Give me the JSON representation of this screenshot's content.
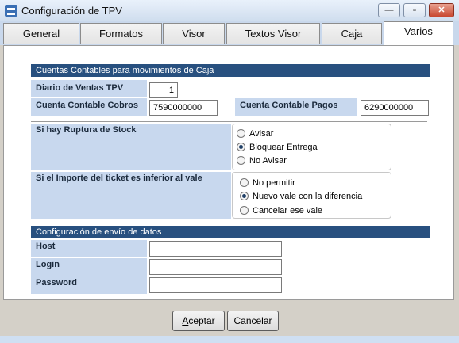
{
  "window": {
    "title": "Configuración de TPV",
    "min_glyph": "—",
    "max_glyph": "▫",
    "close_glyph": "✕"
  },
  "tabs": [
    {
      "label": "General"
    },
    {
      "label": "Formatos"
    },
    {
      "label": "Visor"
    },
    {
      "label": "Textos Visor"
    },
    {
      "label": "Caja"
    },
    {
      "label": "Varios",
      "active": true
    }
  ],
  "section1": {
    "header": "Cuentas Contables para movimientos de Caja",
    "diario_label": "Diario de Ventas TPV",
    "diario_value": "1",
    "cobros_label": "Cuenta Contable Cobros",
    "cobros_value": "7590000000",
    "pagos_label": "Cuenta Contable Pagos",
    "pagos_value": "6290000000"
  },
  "stock": {
    "label": "Si hay Ruptura de Stock",
    "options": [
      "Avisar",
      "Bloquear Entrega",
      "No Avisar"
    ],
    "selected": "Bloquear Entrega"
  },
  "vale": {
    "label": "Si el Importe del ticket es inferior al vale",
    "options": [
      "No permitir",
      "Nuevo vale con la diferencia",
      "Cancelar ese vale"
    ],
    "selected": "Nuevo vale con la diferencia"
  },
  "section2": {
    "header": "Configuración de envío de datos",
    "host_label": "Host",
    "host_value": "",
    "login_label": "Login",
    "login_value": "",
    "password_label": "Password",
    "password_value": ""
  },
  "footer": {
    "accept_first": "A",
    "accept_rest": "ceptar",
    "cancel_label": "Cancelar"
  }
}
